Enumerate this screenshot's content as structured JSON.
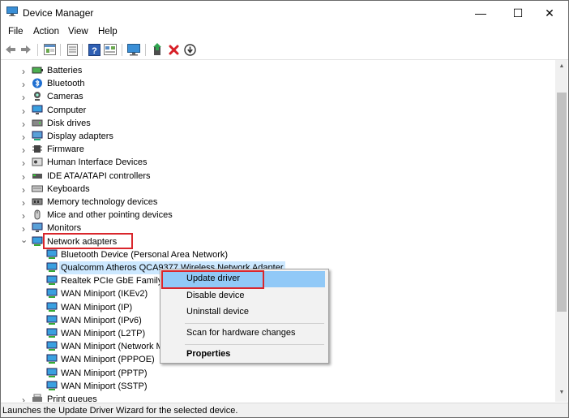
{
  "window": {
    "title": "Device Manager",
    "caption_minimize": "—",
    "caption_maximize": "☐",
    "caption_close": "✕"
  },
  "menu": [
    "File",
    "Action",
    "View",
    "Help"
  ],
  "toolbar_icons": [
    "back-arrow-icon",
    "forward-arrow-icon",
    "properties-icon",
    "help-icon",
    "scan-icon",
    "update-driver-icon",
    "uninstall-icon",
    "download-icon"
  ],
  "tree": {
    "categories": [
      {
        "label": "Batteries",
        "icon": "battery-icon"
      },
      {
        "label": "Bluetooth",
        "icon": "bluetooth-icon"
      },
      {
        "label": "Cameras",
        "icon": "camera-icon"
      },
      {
        "label": "Computer",
        "icon": "computer-icon"
      },
      {
        "label": "Disk drives",
        "icon": "disk-icon"
      },
      {
        "label": "Display adapters",
        "icon": "display-icon"
      },
      {
        "label": "Firmware",
        "icon": "chip-icon"
      },
      {
        "label": "Human Interface Devices",
        "icon": "hid-icon"
      },
      {
        "label": "IDE ATA/ATAPI controllers",
        "icon": "ide-icon"
      },
      {
        "label": "Keyboards",
        "icon": "keyboard-icon"
      },
      {
        "label": "Memory technology devices",
        "icon": "memory-icon"
      },
      {
        "label": "Mice and other pointing devices",
        "icon": "mouse-icon"
      },
      {
        "label": "Monitors",
        "icon": "monitor-icon"
      },
      {
        "label": "Network adapters",
        "icon": "network-icon",
        "expanded": true
      }
    ],
    "network_children": [
      "Bluetooth Device (Personal Area Network)",
      "Qualcomm Atheros QCA9377 Wireless Network Adapter",
      "Realtek PCIe GbE Family C",
      "WAN Miniport (IKEv2)",
      "WAN Miniport (IP)",
      "WAN Miniport (IPv6)",
      "WAN Miniport (L2TP)",
      "WAN Miniport (Network M",
      "WAN Miniport (PPPOE)",
      "WAN Miniport (PPTP)",
      "WAN Miniport (SSTP)"
    ],
    "partial_next": "Print queues"
  },
  "context_menu": {
    "update_driver": "Update driver",
    "disable_device": "Disable device",
    "uninstall_device": "Uninstall device",
    "scan_hardware": "Scan for hardware changes",
    "properties": "Properties"
  },
  "status_bar": "Launches the Update Driver Wizard for the selected device.",
  "colors": {
    "selection": "#cce8ff",
    "highlight_box": "#d9262c",
    "menu_hover": "#91c9f7"
  }
}
